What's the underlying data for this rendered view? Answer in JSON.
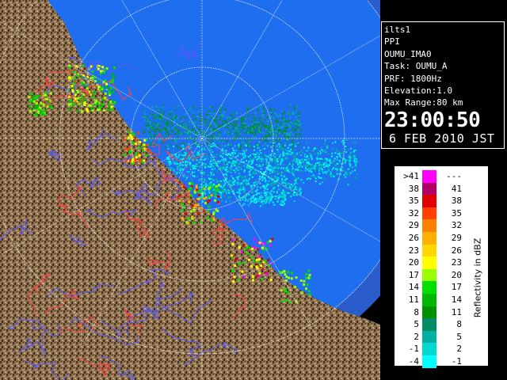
{
  "info": {
    "lines": [
      "ilts1",
      "PPI",
      "OUMU_IMA0",
      "Task: OUMU_A",
      "PRF: 1800Hz",
      "Elevation:1.0",
      "Max Range:80 km"
    ],
    "time": "23:00:50",
    "date": "6 FEB 2010 JST"
  },
  "legend": {
    "title": "Reflectivity in dBZ",
    "rows": [
      {
        "lower": ">41",
        "upper": "---",
        "color": "#ff00ff"
      },
      {
        "lower": "38",
        "upper": "41",
        "color": "#b00064"
      },
      {
        "lower": "35",
        "upper": "38",
        "color": "#e00000"
      },
      {
        "lower": "32",
        "upper": "35",
        "color": "#ff4000"
      },
      {
        "lower": "29",
        "upper": "32",
        "color": "#ff8000"
      },
      {
        "lower": "26",
        "upper": "29",
        "color": "#ffb000"
      },
      {
        "lower": "23",
        "upper": "26",
        "color": "#ffd700"
      },
      {
        "lower": "20",
        "upper": "23",
        "color": "#ffff00"
      },
      {
        "lower": "17",
        "upper": "20",
        "color": "#9aff00"
      },
      {
        "lower": "14",
        "upper": "17",
        "color": "#00e000"
      },
      {
        "lower": "11",
        "upper": "14",
        "color": "#00b800"
      },
      {
        "lower": "8",
        "upper": "11",
        "color": "#009000"
      },
      {
        "lower": "5",
        "upper": "8",
        "color": "#008c64"
      },
      {
        "lower": "2",
        "upper": "5",
        "color": "#00b0a0"
      },
      {
        "lower": "-1",
        "upper": "2",
        "color": "#00d8d0"
      },
      {
        "lower": "-4",
        "upper": "-1",
        "color": "#00ffff"
      }
    ]
  },
  "map": {
    "sea_color": "#1f6ef0",
    "far_sea_color": "#2a5ccc",
    "land_color": "#8a6e4e",
    "land_dark_color": "#3f2f1e",
    "river_color": "#5a5aff",
    "boundary_color": "#ff4040",
    "range_ring_color": "#ffffff"
  }
}
